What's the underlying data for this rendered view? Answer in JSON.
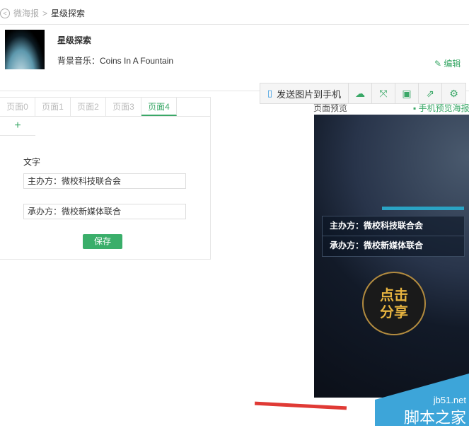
{
  "breadcrumb": {
    "parent": "微海报",
    "current": "星级探索"
  },
  "poster": {
    "title": "星级探索",
    "music": "背景音乐：Coins In A Fountain",
    "edit": "编辑"
  },
  "tabs": [
    "页面0",
    "页面1",
    "页面2",
    "页面3",
    "页面4"
  ],
  "add": "+",
  "form": {
    "label": "文字",
    "field1": "主办方：微校科技联合会",
    "field2": "承办方：微校新媒体联合",
    "save": "保存"
  },
  "toolbar": {
    "send": "发送图片到手机"
  },
  "preview": {
    "label": "页面预览",
    "phone_preview": "手机预览海报",
    "line1": "主办方：微校科技联合会",
    "line2": "承办方：微校新媒体联合",
    "share1": "点击",
    "share2": "分享"
  },
  "watermark": {
    "site": "jb51.net",
    "name": "脚本之家"
  }
}
